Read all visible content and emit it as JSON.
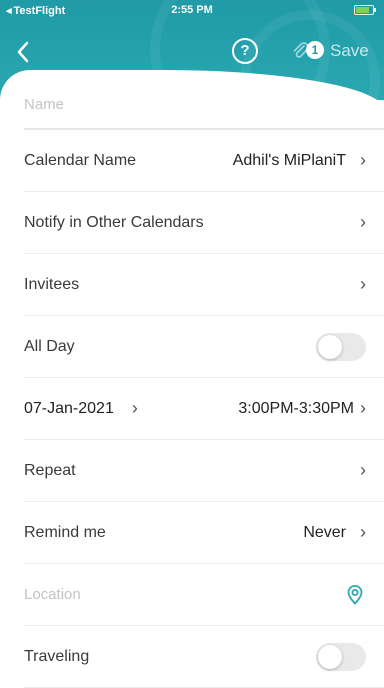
{
  "status_bar": {
    "back_app": "TestFlight",
    "time": "2:55 PM"
  },
  "header": {
    "back_icon": "chevron-left-icon",
    "help_label": "?",
    "attachment_count": "1",
    "save_label": "Save"
  },
  "form": {
    "name_placeholder": "Name",
    "calendar_name_label": "Calendar Name",
    "calendar_name_value": "Adhil's MiPlaniT",
    "notify_label": "Notify in Other Calendars",
    "invitees_label": "Invitees",
    "all_day_label": "All Day",
    "all_day_on": false,
    "date_value": "07-Jan-2021",
    "time_value": "3:00PM-3:30PM",
    "repeat_label": "Repeat",
    "remind_label": "Remind me",
    "remind_value": "Never",
    "location_placeholder": "Location",
    "traveling_label": "Traveling",
    "traveling_on": false
  },
  "colors": {
    "header_teal": "#1f9aa6",
    "accent_teal": "#2aa8b2"
  }
}
